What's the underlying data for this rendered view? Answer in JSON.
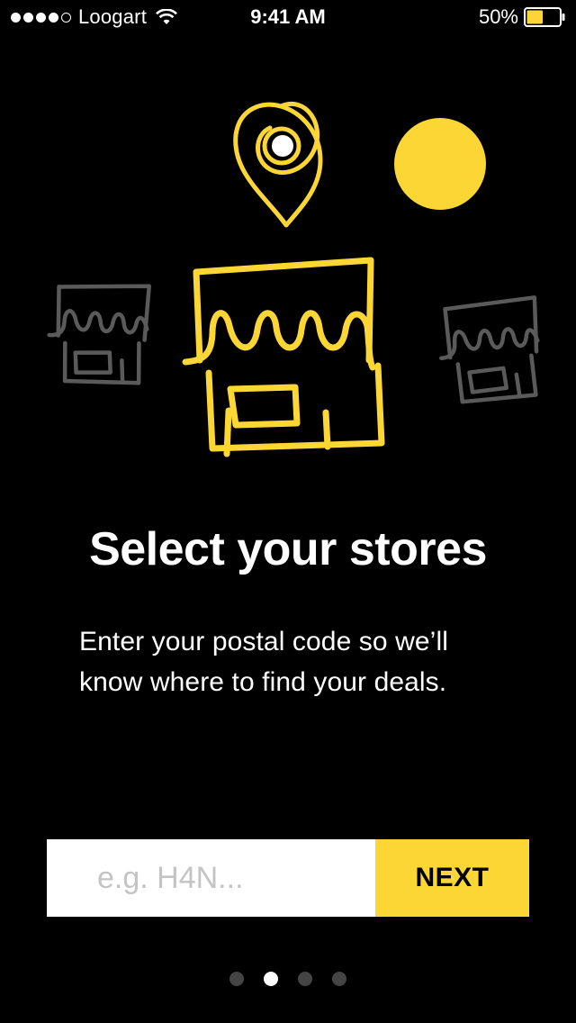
{
  "status_bar": {
    "carrier": "Loogart",
    "time": "9:41 AM",
    "battery": "50%",
    "battery_level": 0.5
  },
  "illustration": {
    "icons": [
      "map-pin-icon",
      "sun-icon",
      "store-icon"
    ],
    "accent_color": "#fcd634",
    "muted_color": "#5a5a5a"
  },
  "onboarding": {
    "title": "Select your stores",
    "description": "Enter your postal code so we’ll know where to find your deals."
  },
  "form": {
    "postal_placeholder": "e.g. H4N...",
    "postal_value": "",
    "next_label": "NEXT"
  },
  "pagination": {
    "total": 4,
    "current": 2
  },
  "colors": {
    "background": "#000000",
    "accent": "#fcd634",
    "text": "#ffffff"
  }
}
